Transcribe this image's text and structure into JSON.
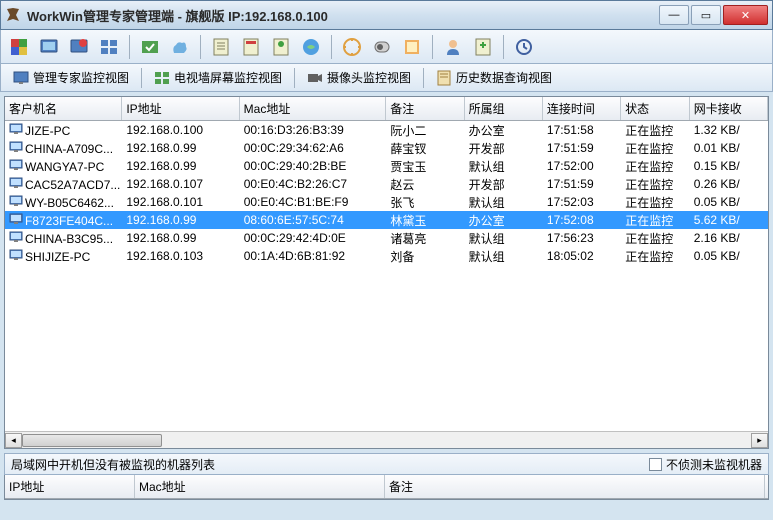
{
  "title": "WorkWin管理专家管理端 - 旗舰版 IP:192.168.0.100",
  "tabs": [
    {
      "label": "管理专家监控视图"
    },
    {
      "label": "电视墙屏幕监控视图"
    },
    {
      "label": "摄像头监控视图"
    },
    {
      "label": "历史数据查询视图"
    }
  ],
  "columns": [
    "客户机名",
    "IP地址",
    "Mac地址",
    "备注",
    "所属组",
    "连接时间",
    "状态",
    "网卡接收"
  ],
  "rows": [
    {
      "name": "JIZE-PC",
      "ip": "192.168.0.100",
      "mac": "00:16:D3:26:B3:39",
      "remark": "阮小二",
      "group": "办公室",
      "time": "17:51:58",
      "status": "正在监控",
      "net": "1.32 KB/",
      "selected": false
    },
    {
      "name": "CHINA-A709C...",
      "ip": "192.168.0.99",
      "mac": "00:0C:29:34:62:A6",
      "remark": "薛宝钗",
      "group": "开发部",
      "time": "17:51:59",
      "status": "正在监控",
      "net": "0.01 KB/",
      "selected": false
    },
    {
      "name": "WANGYA7-PC",
      "ip": "192.168.0.99",
      "mac": "00:0C:29:40:2B:BE",
      "remark": "贾宝玉",
      "group": "默认组",
      "time": "17:52:00",
      "status": "正在监控",
      "net": "0.15 KB/",
      "selected": false
    },
    {
      "name": "CAC52A7ACD7...",
      "ip": "192.168.0.107",
      "mac": "00:E0:4C:B2:26:C7",
      "remark": "赵云",
      "group": "开发部",
      "time": "17:51:59",
      "status": "正在监控",
      "net": "0.26 KB/",
      "selected": false
    },
    {
      "name": "WY-B05C6462...",
      "ip": "192.168.0.101",
      "mac": "00:E0:4C:B1:BE:F9",
      "remark": "张飞",
      "group": "默认组",
      "time": "17:52:03",
      "status": "正在监控",
      "net": "0.05 KB/",
      "selected": false
    },
    {
      "name": "F8723FE404C...",
      "ip": "192.168.0.99",
      "mac": "08:60:6E:57:5C:74",
      "remark": "林黛玉",
      "group": "办公室",
      "time": "17:52:08",
      "status": "正在监控",
      "net": "5.62 KB/",
      "selected": true
    },
    {
      "name": "CHINA-B3C95...",
      "ip": "192.168.0.99",
      "mac": "00:0C:29:42:4D:0E",
      "remark": "诸葛亮",
      "group": "默认组",
      "time": "17:56:23",
      "status": "正在监控",
      "net": "2.16 KB/",
      "selected": false
    },
    {
      "name": "SHIJIZE-PC",
      "ip": "192.168.0.103",
      "mac": "00:1A:4D:6B:81:92",
      "remark": "刘备",
      "group": "默认组",
      "time": "18:05:02",
      "status": "正在监控",
      "net": "0.05 KB/",
      "selected": false
    }
  ],
  "bottom_title": "局域网中开机但没有被监视的机器列表",
  "checkbox_label": "不侦测未监视机器",
  "bottom_columns": [
    "IP地址",
    "Mac地址",
    "备注"
  ]
}
